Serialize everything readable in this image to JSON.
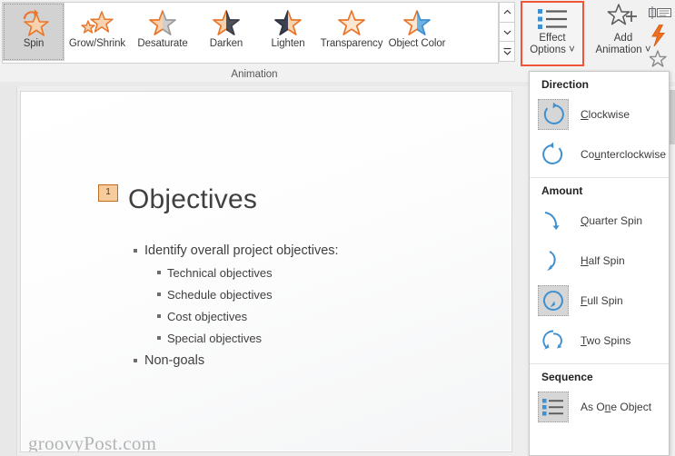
{
  "ribbon": {
    "group_label": "Animation",
    "gallery": [
      {
        "label": "Spin",
        "icon": "spin-star-icon",
        "selected": true
      },
      {
        "label": "Grow/Shrink",
        "icon": "grow-shrink-star-icon",
        "selected": false
      },
      {
        "label": "Desaturate",
        "icon": "desaturate-star-icon",
        "selected": false
      },
      {
        "label": "Darken",
        "icon": "darken-star-icon",
        "selected": false
      },
      {
        "label": "Lighten",
        "icon": "lighten-star-icon",
        "selected": false
      },
      {
        "label": "Transparency",
        "icon": "transparency-star-icon",
        "selected": false
      },
      {
        "label": "Object Color",
        "icon": "object-color-star-icon",
        "selected": false
      }
    ],
    "scroll_buttons": [
      {
        "name": "scroll-up",
        "glyph": "˄"
      },
      {
        "name": "scroll-down",
        "glyph": "˅"
      },
      {
        "name": "more-gallery",
        "glyph": "˅"
      }
    ],
    "effect_options": {
      "line1": "Effect",
      "line2": "Options",
      "chevron": "˅",
      "icon": "effect-options-list-icon",
      "highlight_color": "#f0553c"
    },
    "add_animation": {
      "line1": "Add",
      "line2": "Animation",
      "chevron": "˅",
      "icon": "add-animation-star-plus-icon"
    },
    "right_icons": [
      {
        "name": "animation-pane-icon"
      },
      {
        "name": "trigger-lightning-icon"
      },
      {
        "name": "animation-painter-icon"
      }
    ]
  },
  "menu": {
    "sections": [
      {
        "heading": "Direction",
        "items": [
          {
            "label": "Clockwise",
            "accel": "C",
            "icon": "clockwise-arrow-icon",
            "selected": true
          },
          {
            "label": "Counterclockwise",
            "accel": "u",
            "icon": "counterclockwise-arrow-icon",
            "selected": false
          }
        ]
      },
      {
        "heading": "Amount",
        "items": [
          {
            "label": "Quarter Spin",
            "accel": "Q",
            "icon": "quarter-spin-icon",
            "selected": false
          },
          {
            "label": "Half Spin",
            "accel": "H",
            "icon": "half-spin-icon",
            "selected": false
          },
          {
            "label": "Full Spin",
            "accel": "F",
            "icon": "full-spin-icon",
            "selected": true
          },
          {
            "label": "Two Spins",
            "accel": "T",
            "icon": "two-spins-icon",
            "selected": false
          }
        ]
      },
      {
        "heading": "Sequence",
        "items": [
          {
            "label": "As One Object",
            "accel": "n",
            "icon": "as-one-object-icon",
            "selected": true
          }
        ]
      }
    ]
  },
  "slide": {
    "animation_badge": "1",
    "title": "Objectives",
    "bullets": [
      {
        "level": 1,
        "text": "Identify overall project objectives:"
      },
      {
        "level": 2,
        "text": "Technical objectives"
      },
      {
        "level": 2,
        "text": "Schedule objectives"
      },
      {
        "level": 2,
        "text": "Cost objectives"
      },
      {
        "level": 2,
        "text": "Special objectives"
      },
      {
        "level": 1,
        "text": "Non-goals"
      }
    ]
  },
  "watermark": "groovyPost.com",
  "colors": {
    "accent_orange": "#e8762c",
    "star_fill": "#f6d3ae",
    "highlight_red": "#f0553c",
    "menu_blue": "#3f90d0",
    "badge_fill": "#f8cb9c"
  }
}
